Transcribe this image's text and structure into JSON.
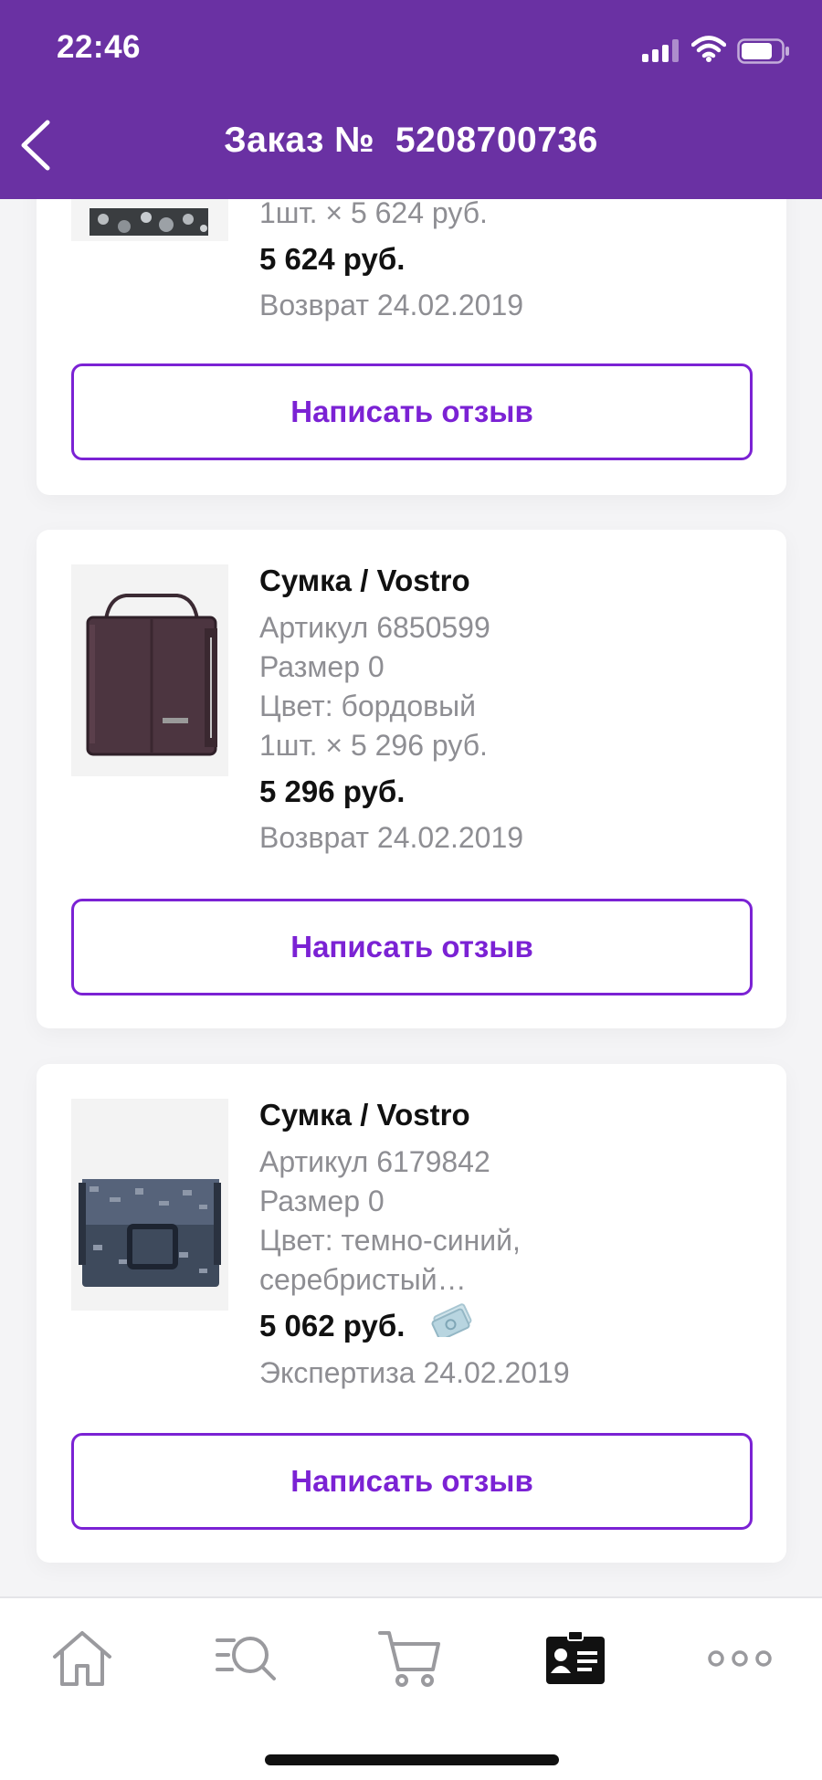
{
  "status_bar": {
    "time": "22:46"
  },
  "nav": {
    "title": "Заказ №  5208700736"
  },
  "items": [
    {
      "quantity_line": "1шт. × 5 624 руб.",
      "total": "5 624 руб.",
      "status": "Возврат 24.02.2019",
      "review_label": "Написать отзыв"
    },
    {
      "name": "Сумка / Vostro",
      "article": "Артикул 6850599",
      "size": "Размер 0",
      "color": "Цвет: бордовый",
      "quantity_line": "1шт. × 5 296 руб.",
      "total": "5 296 руб.",
      "status": "Возврат 24.02.2019",
      "review_label": "Написать отзыв"
    },
    {
      "name": "Сумка / Vostro",
      "article": "Артикул 6179842",
      "size": "Размер 0",
      "color_line1": "Цвет: темно-синий,",
      "color_line2": "серебристый…",
      "total": "5 062 руб.",
      "status": "Экспертиза 24.02.2019",
      "review_label": "Написать отзыв",
      "price_icon": "money-icon"
    }
  ],
  "tabbar": {
    "tabs": [
      {
        "icon": "home-icon",
        "active": false
      },
      {
        "icon": "search-icon",
        "active": false
      },
      {
        "icon": "cart-icon",
        "active": false
      },
      {
        "icon": "profile-card-icon",
        "active": true
      },
      {
        "icon": "more-icon",
        "active": false
      }
    ]
  },
  "colors": {
    "header_bg": "#6a31a3",
    "accent": "#7b22d4",
    "secondary_text": "#8e8e93"
  }
}
